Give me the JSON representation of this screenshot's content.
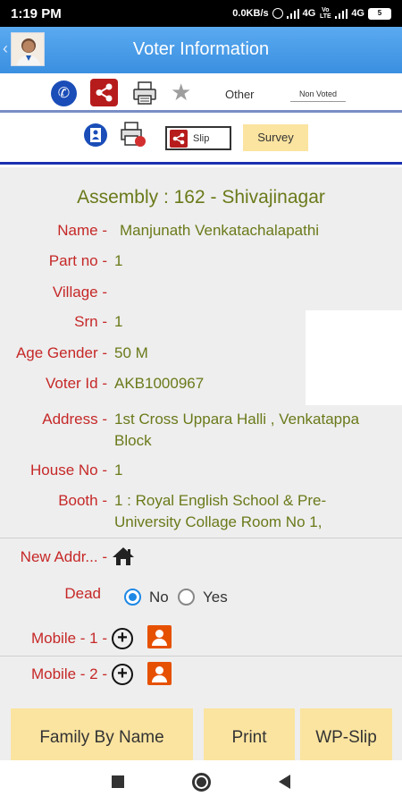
{
  "status_bar": {
    "time": "1:19 PM",
    "net_speed": "0.0KB/s",
    "network1": "4G",
    "volte": "Vo LTE",
    "network2": "4G",
    "battery": "5"
  },
  "header": {
    "title": "Voter Information"
  },
  "toolbar": {
    "other_label": "Other",
    "status_select": "Non Voted",
    "slip_label": "Slip",
    "survey_label": "Survey"
  },
  "voter": {
    "assembly": "Assembly : 162 - Shivajinagar",
    "fields": [
      {
        "label": "Name -",
        "value": "Manjunath Venkatachalapathi"
      },
      {
        "label": "Part no -",
        "value": "1"
      },
      {
        "label": "Village -",
        "value": ""
      },
      {
        "label": "Srn -",
        "value": "1"
      },
      {
        "label": "Age Gender -",
        "value": "50 M"
      },
      {
        "label": "Voter Id -",
        "value": "AKB1000967"
      },
      {
        "label": "Address -",
        "value": "1st Cross Uppara Halli , Venkatappa Block"
      },
      {
        "label": "House No -",
        "value": "1"
      },
      {
        "label": "Booth -",
        "value": "1 : Royal English School & Pre-University Collage Room No 1,"
      }
    ]
  },
  "extra": {
    "new_address_label": "New Addr... -",
    "dead_label": "Dead",
    "dead_options": [
      "No",
      "Yes"
    ],
    "dead_selected": "No",
    "mobile1_label": "Mobile - 1 -",
    "mobile2_label": "Mobile - 2 -"
  },
  "buttons": {
    "family": "Family By Name",
    "print": "Print",
    "wpslip": "WP-Slip"
  },
  "colors": {
    "header_bg": "#3a8fe0",
    "label_red": "#c62828",
    "value_olive": "#6a7a1a",
    "button_yellow": "#fbe4a0"
  }
}
